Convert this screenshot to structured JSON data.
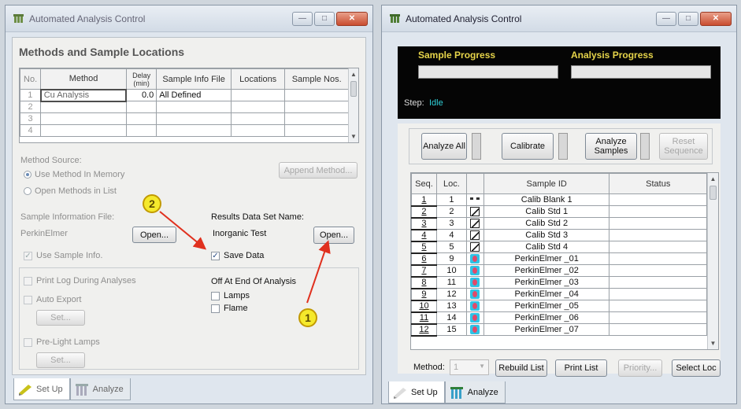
{
  "left_window": {
    "title": "Automated Analysis Control",
    "section_title": "Methods and Sample Locations",
    "table": {
      "headers": [
        "No.",
        "Method",
        "Delay (min)",
        "Sample Info File",
        "Locations",
        "Sample Nos."
      ],
      "rows": [
        {
          "no": "1",
          "method": "Cu Analysis",
          "delay": "0.0",
          "info": "All Defined",
          "loc": "",
          "nos": ""
        },
        {
          "no": "2",
          "method": "",
          "delay": "",
          "info": "",
          "loc": "",
          "nos": ""
        },
        {
          "no": "3",
          "method": "",
          "delay": "",
          "info": "",
          "loc": "",
          "nos": ""
        },
        {
          "no": "4",
          "method": "",
          "delay": "",
          "info": "",
          "loc": "",
          "nos": ""
        }
      ]
    },
    "method_source_label": "Method Source:",
    "radio_memory": "Use Method In Memory",
    "radio_list": "Open Methods in List",
    "append_button": "Append Method...",
    "sample_info_label": "Sample Information File:",
    "sample_info_value": "PerkinElmer",
    "open_button_1": "Open...",
    "results_label": "Results Data Set Name:",
    "results_value": "Inorganic Test",
    "open_button_2": "Open...",
    "use_sample_info": "Use Sample Info.",
    "save_data": "Save Data",
    "print_log": "Print Log During Analyses",
    "off_at_end": "Off At End Of Analysis",
    "lamps": "Lamps",
    "flame": "Flame",
    "auto_export": "Auto Export",
    "set_button_1": "Set...",
    "pre_light": "Pre-Light Lamps",
    "set_button_2": "Set...",
    "callout_1": "1",
    "callout_2": "2",
    "tab_setup": "Set Up",
    "tab_analyze": "Analyze",
    "arrow_color": "#e0301e",
    "callout_color": "#f5e92c"
  },
  "right_window": {
    "title": "Automated Analysis Control",
    "sample_progress_label": "Sample Progress",
    "analysis_progress_label": "Analysis Progress",
    "step_label": "Step:",
    "step_value": "Idle",
    "analyze_all": "Analyze All",
    "calibrate": "Calibrate",
    "analyze_samples_1": "Analyze",
    "analyze_samples_2": "Samples",
    "reset_1": "Reset",
    "reset_2": "Sequence",
    "table": {
      "headers": [
        "Seq.",
        "Loc.",
        "",
        "Sample ID",
        "Status"
      ],
      "rows": [
        {
          "seq": "1",
          "loc": "1",
          "marker": "blank",
          "id": "Calib Blank 1",
          "status": ""
        },
        {
          "seq": "2",
          "loc": "2",
          "marker": "check",
          "id": "Calib Std 1",
          "status": ""
        },
        {
          "seq": "3",
          "loc": "3",
          "marker": "check",
          "id": "Calib Std 2",
          "status": ""
        },
        {
          "seq": "4",
          "loc": "4",
          "marker": "check",
          "id": "Calib Std 3",
          "status": ""
        },
        {
          "seq": "5",
          "loc": "5",
          "marker": "check",
          "id": "Calib Std 4",
          "status": ""
        },
        {
          "seq": "6",
          "loc": "9",
          "marker": "beaker",
          "id": "PerkinElmer _01",
          "status": ""
        },
        {
          "seq": "7",
          "loc": "10",
          "marker": "beaker",
          "id": "PerkinElmer _02",
          "status": ""
        },
        {
          "seq": "8",
          "loc": "11",
          "marker": "beaker",
          "id": "PerkinElmer _03",
          "status": ""
        },
        {
          "seq": "9",
          "loc": "12",
          "marker": "beaker",
          "id": "PerkinElmer _04",
          "status": ""
        },
        {
          "seq": "10",
          "loc": "13",
          "marker": "beaker",
          "id": "PerkinElmer _05",
          "status": ""
        },
        {
          "seq": "11",
          "loc": "14",
          "marker": "beaker",
          "id": "PerkinElmer _06",
          "status": ""
        },
        {
          "seq": "12",
          "loc": "15",
          "marker": "beaker",
          "id": "PerkinElmer _07",
          "status": ""
        }
      ]
    },
    "method_label": "Method:",
    "method_value": "1",
    "rebuild_list": "Rebuild List",
    "print_list": "Print List",
    "priority": "Priority...",
    "select_loc": "Select Loc",
    "tab_setup": "Set Up",
    "tab_analyze": "Analyze",
    "label_color": "#e6d44a",
    "step_color": "#2fd0d8"
  }
}
